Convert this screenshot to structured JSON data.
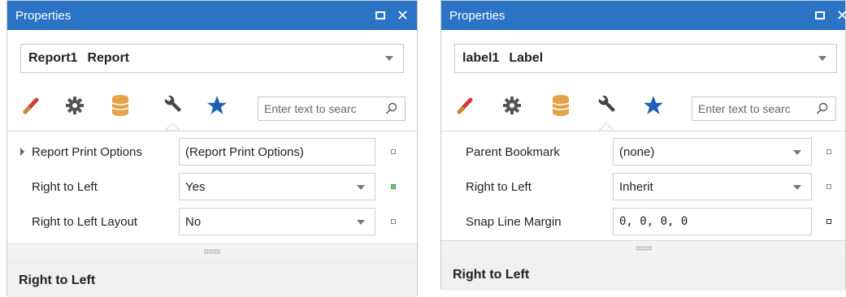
{
  "colors": {
    "titlebar": "#2b73c4",
    "accent_star": "#1f5fb8",
    "modified_marker": "#7cc57c"
  },
  "panel_left": {
    "title": "Properties",
    "combo": {
      "name": "Report1",
      "type": "Report"
    },
    "toolbar": {
      "icons": [
        "appearance-brush-icon",
        "behavior-gear-icon",
        "data-database-icon",
        "design-wrench-icon",
        "favorites-star-icon"
      ]
    },
    "search_placeholder": "Enter text to searc",
    "rows": [
      {
        "label": "Report Print Options",
        "value": "(Report Print Options)"
      },
      {
        "label": "Right to Left",
        "value": "Yes"
      },
      {
        "label": "Right to Left Layout",
        "value": "No"
      }
    ],
    "description_title": "Right to Left"
  },
  "panel_right": {
    "title": "Properties",
    "combo": {
      "name": "label1",
      "type": "Label"
    },
    "toolbar": {
      "icons": [
        "appearance-brush-icon",
        "behavior-gear-icon",
        "data-database-icon",
        "design-wrench-icon",
        "favorites-star-icon"
      ]
    },
    "search_placeholder": "Enter text to searc",
    "rows": [
      {
        "label": "Parent Bookmark",
        "value": "(none)"
      },
      {
        "label": "Right to Left",
        "value": "Inherit"
      },
      {
        "label": "Snap Line Margin",
        "value": "0, 0, 0, 0"
      }
    ],
    "description_title": "Right to Left"
  }
}
